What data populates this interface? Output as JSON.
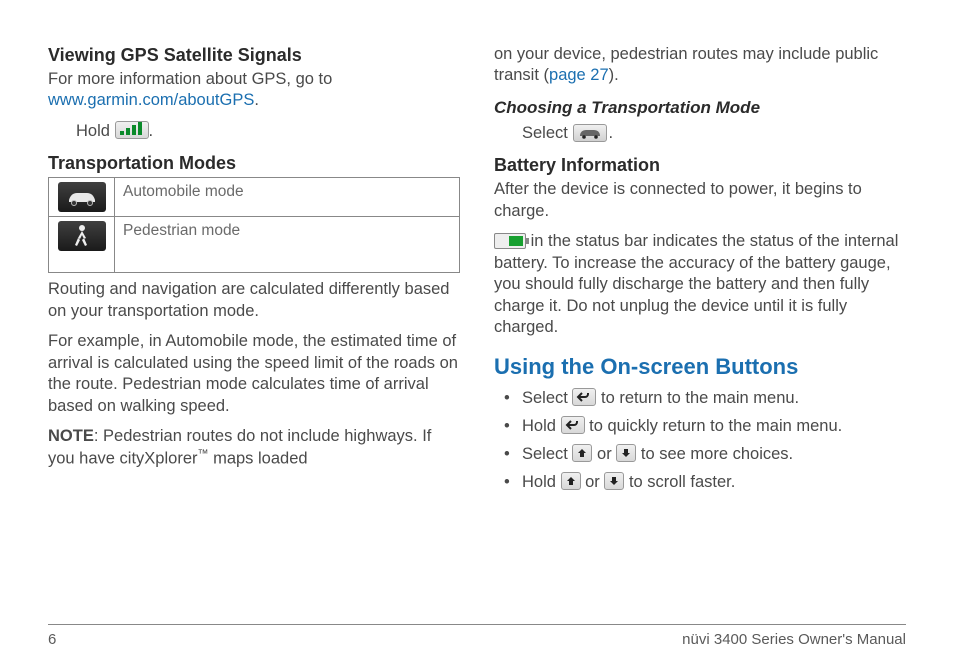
{
  "left": {
    "h_gps": "Viewing GPS Satellite Signals",
    "gps_intro": "For more information about GPS, go to ",
    "gps_link": "www.garmin.com/aboutGPS",
    "gps_period": ".",
    "hold": "Hold ",
    "hold_end": ".",
    "h_transport": "Transportation Modes",
    "table": {
      "auto": "Automobile mode",
      "ped": "Pedestrian mode"
    },
    "routing": "Routing and navigation are calculated differently based on your transportation mode.",
    "example": "For example, in Automobile mode, the estimated time of arrival is calculated using the speed limit of the roads on the route. Pedestrian mode calculates time of arrival based on walking speed.",
    "note_label": "NOTE",
    "note_text": ": Pedestrian routes do not include highways. If you have cityXplorer",
    "note_tm": "™",
    "note_tail": " maps loaded"
  },
  "right": {
    "cont": "on your device, pedestrian routes may include public transit (",
    "page_link": "page 27",
    "cont_end": ").",
    "h_choose": "Choosing a Transportation Mode",
    "select": "Select ",
    "select_end": ".",
    "h_battery": "Battery Information",
    "battery_p1": "After the device is connected to power, it begins to charge.",
    "battery_p2a": " in the status bar indicates the status of the internal battery. To increase the accuracy of the battery gauge, you should fully discharge the battery and then fully charge it. Do not unplug the device until it is fully charged.",
    "h_onscreen": "Using the On-screen Buttons",
    "bullets": {
      "b1a": "Select ",
      "b1b": " to return to the main menu.",
      "b2a": "Hold ",
      "b2b": " to quickly return to the main menu.",
      "b3a": "Select ",
      "b3mid": " or ",
      "b3b": " to see more choices.",
      "b4a": "Hold ",
      "b4mid": " or ",
      "b4b": " to scroll faster."
    }
  },
  "footer": {
    "page": "6",
    "title": "nüvi 3400 Series Owner's Manual"
  }
}
